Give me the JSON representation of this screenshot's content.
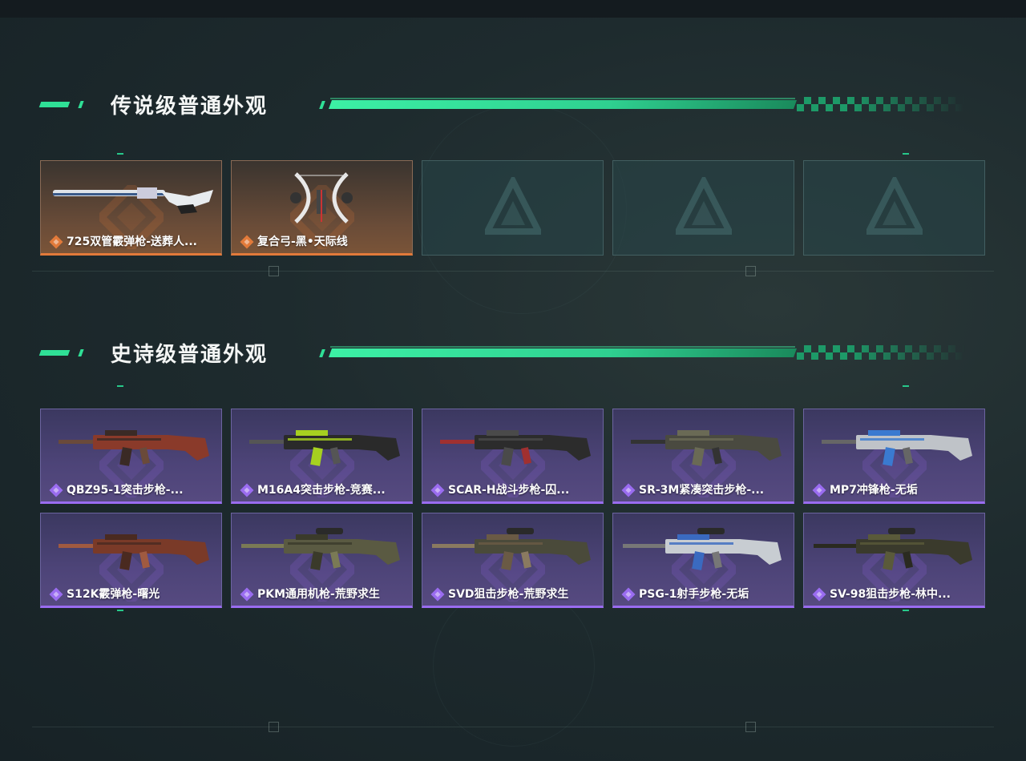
{
  "theme": {
    "accent": "#2fe096",
    "legendary_color": "#e27a3a",
    "epic_color": "#9a6cf0"
  },
  "sections": [
    {
      "title": "传说级普通外观",
      "rarity": "legendary",
      "items": [
        {
          "label": "725双管霰弹枪-送葬人...",
          "icon": "shotgun-icon",
          "empty": false
        },
        {
          "label": "复合弓-黑•天际线",
          "icon": "compound-bow-icon",
          "empty": false
        },
        {
          "label": "",
          "icon": "empty-slot-logo",
          "empty": true
        },
        {
          "label": "",
          "icon": "empty-slot-logo",
          "empty": true
        },
        {
          "label": "",
          "icon": "empty-slot-logo",
          "empty": true
        }
      ]
    },
    {
      "title": "史诗级普通外观",
      "rarity": "epic",
      "items": [
        {
          "label": "QBZ95-1突击步枪-...",
          "icon": "assault-rifle-icon"
        },
        {
          "label": "M16A4突击步枪-竞赛...",
          "icon": "assault-rifle-icon"
        },
        {
          "label": "SCAR-H战斗步枪-囚...",
          "icon": "battle-rifle-icon"
        },
        {
          "label": "SR-3M紧凑突击步枪-...",
          "icon": "compact-rifle-icon"
        },
        {
          "label": "MP7冲锋枪-无垢",
          "icon": "smg-icon"
        },
        {
          "label": "S12K霰弹枪-曙光",
          "icon": "shotgun-icon"
        },
        {
          "label": "PKM通用机枪-荒野求生",
          "icon": "machine-gun-icon"
        },
        {
          "label": "SVD狙击步枪-荒野求生",
          "icon": "sniper-rifle-icon"
        },
        {
          "label": "PSG-1射手步枪-无垢",
          "icon": "marksman-rifle-icon"
        },
        {
          "label": "SV-98狙击步枪-林中...",
          "icon": "sniper-rifle-icon"
        }
      ]
    }
  ]
}
